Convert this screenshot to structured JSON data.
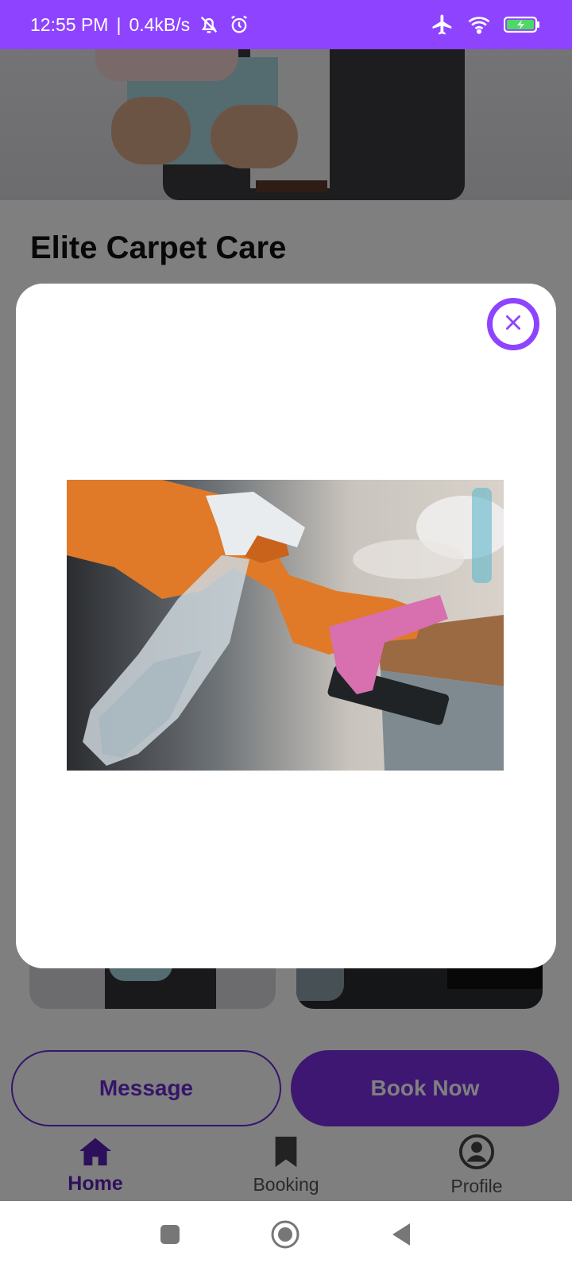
{
  "status_bar": {
    "time": "12:55 PM",
    "separator": "|",
    "speed": "0.4kB/s",
    "icons": [
      "bell-off-icon",
      "alarm-icon",
      "airplane-icon",
      "wifi-icon",
      "battery-charging-icon"
    ]
  },
  "business": {
    "title": "Elite Carpet Care"
  },
  "actions": {
    "message_label": "Message",
    "book_label": "Book Now"
  },
  "bottom_nav": {
    "items": [
      {
        "label": "Home",
        "icon": "home-icon",
        "active": true
      },
      {
        "label": "Booking",
        "icon": "bookmark-icon",
        "active": false
      },
      {
        "label": "Profile",
        "icon": "profile-icon",
        "active": false
      }
    ]
  },
  "modal": {
    "close_icon": "close-icon",
    "image_subject": "cleaning-photo"
  },
  "colors": {
    "accent": "#8e44ff",
    "primary_button": "#7a2fe3",
    "active_nav": "#5b21b6"
  }
}
